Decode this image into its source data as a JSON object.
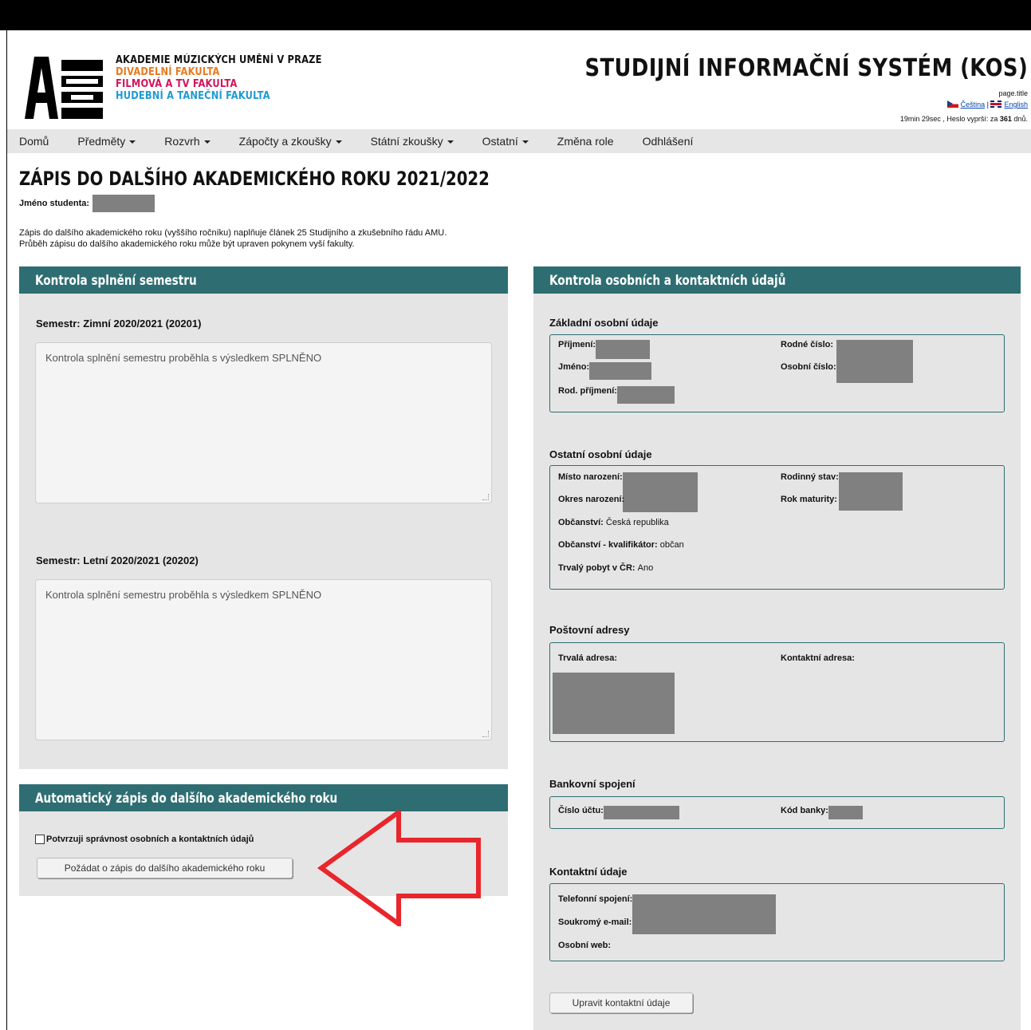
{
  "header": {
    "logo_lines": [
      {
        "text": "AKADEMIE MÚZICKÝCH UMĚNÍ V PRAZE",
        "color": "#111111"
      },
      {
        "text": "DIVADELNÍ FAKULTA",
        "color": "#e87b1e"
      },
      {
        "text": "FILMOVÁ A TV FAKULTA",
        "color": "#d3145a"
      },
      {
        "text": "HUDEBNÍ A TANEČNÍ FAKULTA",
        "color": "#1e9ad6"
      }
    ],
    "system_title": "STUDIJNÍ INFORMAČNÍ SYSTÉM (KOS)",
    "page_title_placeholder": "page.title",
    "lang_cz": "Čeština",
    "lang_sep": "|",
    "lang_en": "English",
    "session_text": "19min 29sec ,  Heslo vyprší: za",
    "password_days": "361",
    "days_unit": "dnů."
  },
  "nav": [
    {
      "label": "Domů",
      "dropdown": false
    },
    {
      "label": "Předměty",
      "dropdown": true
    },
    {
      "label": "Rozvrh",
      "dropdown": true
    },
    {
      "label": "Zápočty a zkoušky",
      "dropdown": true
    },
    {
      "label": "Státní zkoušky",
      "dropdown": true
    },
    {
      "label": "Ostatní",
      "dropdown": true
    },
    {
      "label": "Změna role",
      "dropdown": false
    },
    {
      "label": "Odhlášení",
      "dropdown": false
    }
  ],
  "page": {
    "title": "ZÁPIS DO DALŠÍHO AKADEMICKÉHO ROKU 2021/2022",
    "student_label": "Jméno studenta:",
    "intro_line1": "Zápis do dalšího akademického roku (vyššího ročníku) naplňuje článek 25 Studijního a zkušebního řádu AMU.",
    "intro_line2": "Průběh zápisu do dalšího akademického roku může být upraven pokynem vyší fakulty."
  },
  "semester_panel": {
    "heading": "Kontrola splnění semestru",
    "semesters": [
      {
        "label": "Semestr:  Zimní 2020/2021  (20201)",
        "text": "Kontrola splnění semestru proběhla s výsledkem SPLNĚNO"
      },
      {
        "label": "Semestr:  Letní 2020/2021  (20202)",
        "text": "Kontrola splnění semestru proběhla s výsledkem SPLNĚNO"
      }
    ]
  },
  "auto_panel": {
    "heading": "Automatický zápis do dalšího akademického roku",
    "confirm_label": "Potvrzuji správnost osobních a kontaktních údajů",
    "confirm_checked": false,
    "request_button": "Požádat o zápis do dalšího akademického roku"
  },
  "personal_panel": {
    "heading": "Kontrola osobních a kontaktních údajů",
    "basic": {
      "title": "Základní osobní údaje",
      "surname": "Příjmení:",
      "name": "Jméno:",
      "birth_surname": "Rod. příjmení:",
      "birth_number": "Rodné číslo:",
      "personal_number": "Osobní číslo:"
    },
    "other": {
      "title": "Ostatní osobní údaje",
      "birthplace": "Místo narození:",
      "birth_district": "Okres narození:",
      "citizenship_label": "Občanství:",
      "citizenship_value": "Česká republika",
      "citizenship_qual_label": "Občanství - kvalifikátor:",
      "citizenship_qual_value": "občan",
      "residence_label": "Trvalý pobyt v ČR:",
      "residence_value": "Ano",
      "marital_status": "Rodinný stav:",
      "graduation_year": "Rok maturity:"
    },
    "postal": {
      "title": "Poštovní adresy",
      "permanent": "Trvalá adresa:",
      "contact": "Kontaktní adresa:"
    },
    "bank": {
      "title": "Bankovní spojení",
      "account": "Číslo účtu:",
      "bank_code": "Kód banky:"
    },
    "contact": {
      "title": "Kontaktní údaje",
      "phone": "Telefonní spojení:",
      "email": "Soukromý e-mail:",
      "web": "Osobní web:"
    },
    "edit_button": "Upravit kontaktní údaje"
  },
  "colors": {
    "accent": "#2e6e72",
    "panel_bg": "#e5e5e5",
    "redaction": "#808080",
    "arrow": "#e8262c"
  }
}
